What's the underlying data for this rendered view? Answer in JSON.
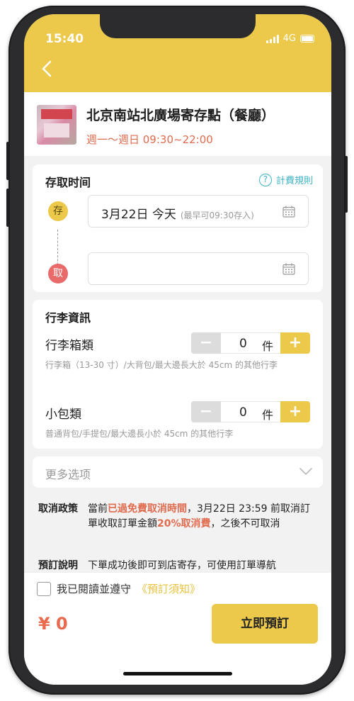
{
  "status_bar": {
    "time": "15:40",
    "network": "4G"
  },
  "store": {
    "name": "北京南站北廣場寄存點（餐廳）",
    "hours": "週一～週日 09:30~22:00"
  },
  "pickup_card": {
    "title": "存取时间",
    "fee_link": "計費規則",
    "deposit_marker": "存",
    "pickup_marker": "取",
    "deposit_date": "3月22日 今天",
    "deposit_hint": "(最早可09:30存入)",
    "pickup_date": ""
  },
  "luggage_card": {
    "title": "行李資訊",
    "items": [
      {
        "label": "行李箱類",
        "count": "0",
        "unit": "件",
        "desc": "行李箱（13-30 寸）/大背包/最大邊長大於 45cm 的其他行李"
      },
      {
        "label": "小包類",
        "count": "0",
        "unit": "件",
        "desc": "普通背包/手提包/最大邊長小於 45cm 的其他行李"
      }
    ],
    "minus": "−",
    "plus": "+"
  },
  "more_options": {
    "label": "更多选项"
  },
  "policies": {
    "cancel_key": "取消政策",
    "cancel_p1": "當前",
    "cancel_highlight1": "已過免費取消時間",
    "cancel_p2": "，3月22日 23:59 前取消訂單收取訂單金額",
    "cancel_highlight2": "20%取消費",
    "cancel_p3": "，之後不可取消",
    "booking_key": "預訂說明",
    "booking_text": "下單成功後即可到店寄存，可使用訂單導航"
  },
  "footer": {
    "agree_text": "我已閱讀並遵守",
    "agree_link": "《預訂須知》",
    "price": "¥ 0",
    "book_button": "立即預訂"
  },
  "colors": {
    "accent": "#ecc94b",
    "price_red": "#e96a4e",
    "link_teal": "#3cb3c4"
  }
}
